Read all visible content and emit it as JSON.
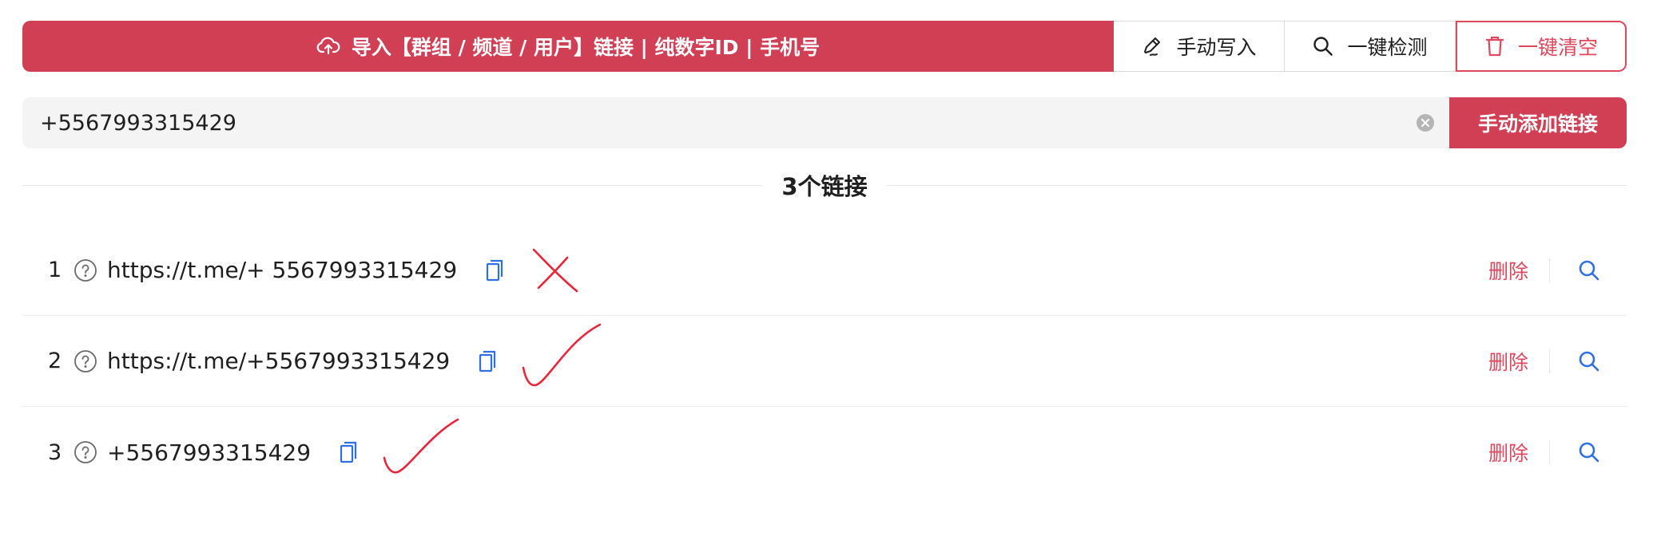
{
  "toolbar": {
    "import_label": "导入【群组 / 频道 / 用户】链接 | 纯数字ID | 手机号",
    "manual_write_label": "手动写入",
    "check_label": "一键检测",
    "clear_label": "一键清空"
  },
  "input": {
    "value": "+5567993315429",
    "add_button_label": "手动添加链接"
  },
  "divider": {
    "label": "3个链接"
  },
  "links": [
    {
      "index": "1",
      "text": "https://t.me/+ 5567993315429",
      "delete_label": "删除",
      "annotation": "cross"
    },
    {
      "index": "2",
      "text": "https://t.me/+5567993315429",
      "delete_label": "删除",
      "annotation": "check"
    },
    {
      "index": "3",
      "text": "+5567993315429",
      "delete_label": "删除",
      "annotation": "check"
    }
  ],
  "colors": {
    "primary": "#d13f55",
    "danger_text": "#e0475d",
    "link_icon": "#2f6fe4",
    "annotation_red": "#e8263a"
  }
}
